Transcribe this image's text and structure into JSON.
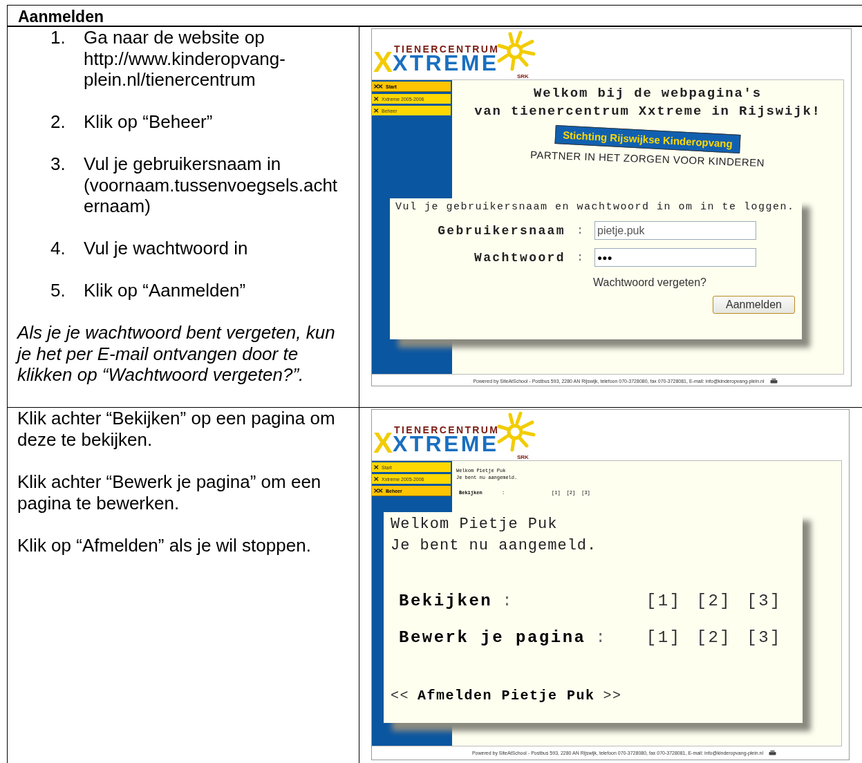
{
  "document": {
    "heading": "Aanmelden"
  },
  "rows": [
    {
      "kind": "steps",
      "steps": [
        {
          "number": "1.",
          "text": "Ga naar de website op http://www.kinderopvang-plein.nl/tienercentrum"
        },
        {
          "number": "2.",
          "text": "Klik op “Beheer”"
        },
        {
          "number": "3.",
          "text": "Vul je gebruikersnaam in (voornaam.tussenvoegsels.achternaam)"
        },
        {
          "number": "4.",
          "text": "Vul je wachtwoord in"
        },
        {
          "number": "5.",
          "text": "Klik op “Aanmelden”"
        }
      ],
      "note": "Als je je wachtwoord bent vergeten, kun je het per E-mail ontvangen door te klikken op “Wachtwoord vergeten?”.",
      "screenshot": {
        "kind": "login",
        "logo": {
          "top": "TIENERCENTRUM",
          "initial": "X",
          "main": "XTREME",
          "small": "SRK"
        },
        "menu": [
          {
            "label": "Start",
            "selected": true
          },
          {
            "label": "Xxtreme 2005-2006",
            "selected": false
          },
          {
            "label": "Beheer",
            "selected": false
          }
        ],
        "welcome": [
          "Welkom bij de webpagina's",
          "van tienercentrum Xxtreme in Rijswijk!"
        ],
        "banner": {
          "title": "Stichting Rijswijkse Kinderopvang",
          "tagline": "PARTNER IN HET ZORGEN VOOR KINDEREN"
        },
        "login": {
          "intro": "Vul je gebruikersnaam en wachtwoord in om in te loggen.",
          "fields": [
            {
              "label": "Gebruikersnaam",
              "separator": ":",
              "value": "pietje.puk"
            },
            {
              "label": "Wachtwoord",
              "separator": ":",
              "value": "●●●"
            }
          ],
          "forgot_link": "Wachtwoord vergeten?",
          "submit": "Aanmelden"
        },
        "footer": "Powered by SiteAtSchool - Postbus 593, 2280 AN Rijswijk, telefoon 070-3728080, fax 070-3728081, E-mail: info@kinderopvang-plein.nl"
      }
    },
    {
      "kind": "paragraphs",
      "paragraphs": [
        "Klik achter “Bekijken” op een pagina om deze te bekijken.",
        "Klik achter “Bewerk je pagina” om een pagina te bewerken.",
        "Klik op “Afmelden” als je wil stoppen."
      ],
      "screenshot": {
        "kind": "dashboard",
        "logo": {
          "top": "TIENERCENTRUM",
          "initial": "X",
          "main": "XTREME",
          "small": "SRK"
        },
        "menu": [
          {
            "label": "Start",
            "selected": false
          },
          {
            "label": "Xxtreme 2005-2006",
            "selected": false
          },
          {
            "label": "Beheer",
            "selected": true
          }
        ],
        "background": {
          "lines": [
            "Welkom Pietje Puk",
            "Je bent nu aangemeld."
          ],
          "rows": [
            {
              "label": "Bekijken",
              "separator": ":",
              "links": [
                "[1]",
                "[2]",
                "[3]"
              ]
            }
          ]
        },
        "panel": {
          "lines": [
            "Welkom Pietje Puk",
            "Je bent nu aangemeld."
          ],
          "rows": [
            {
              "label": "Bekijken",
              "separator": ":",
              "links": [
                "[1]",
                "[2]",
                "[3]"
              ]
            },
            {
              "label": "Bewerk je pagina",
              "separator": ":",
              "links": [
                "[1]",
                "[2]",
                "[3]"
              ]
            }
          ],
          "logout": {
            "left": "<<",
            "label": "Afmelden Pietje Puk",
            "right": ">>"
          }
        },
        "footer": "Powered by SiteAtSchool - Postbus 593, 2280 AN Rijswijk, telefoon 070-3728080, fax 070-3728081, E-mail: info@kinderopvang-plein.nl"
      }
    }
  ]
}
